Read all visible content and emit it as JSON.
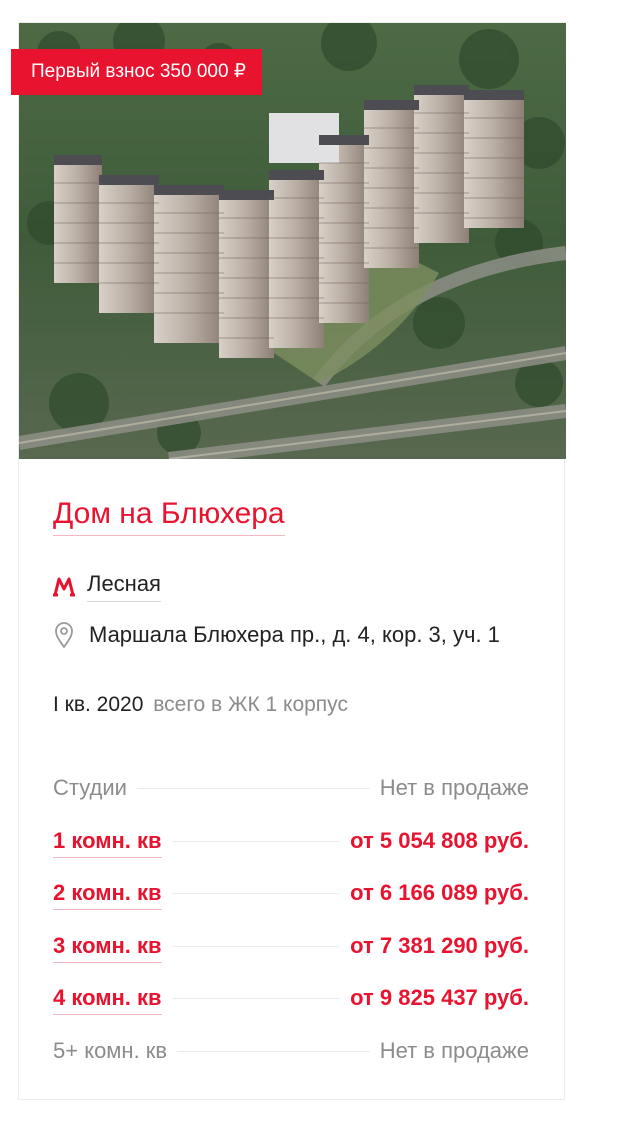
{
  "badge": {
    "text": "Первый взнос 350 000 ₽"
  },
  "complex": {
    "title": "Дом на Блюхера",
    "metro": "Лесная",
    "address": "Маршала Блюхера пр., д. 4, кор. 3, уч. 1",
    "deadline": "I кв. 2020",
    "deadline_note": "всего в ЖК 1 корпус"
  },
  "rooms": [
    {
      "label": "Студии",
      "price": "Нет в продаже"
    },
    {
      "label": "1 комн. кв",
      "price": "от 5 054 808 руб."
    },
    {
      "label": "2 комн. кв",
      "price": "от 6 166 089 руб."
    },
    {
      "label": "3 комн. кв",
      "price": "от 7 381 290 руб."
    },
    {
      "label": "4 комн. кв",
      "price": "от 9 825 437 руб."
    },
    {
      "label": "5+ комн. кв",
      "price": "Нет в продаже"
    }
  ],
  "colors": {
    "accent": "#e8132f",
    "muted": "#8c8c8c",
    "text": "#222222"
  },
  "icons": {
    "metro": "metro-icon",
    "address": "map-pin-icon"
  }
}
